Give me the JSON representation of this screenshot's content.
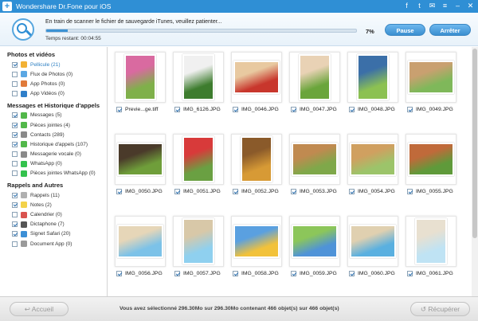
{
  "window": {
    "title": "Wondershare Dr.Fone pour iOS",
    "app_icon": "+"
  },
  "titlebar_icons": [
    "facebook-icon",
    "twitter-icon",
    "feedback-icon",
    "menu-icon",
    "minimize-icon",
    "close-icon"
  ],
  "titlebar_glyphs": [
    "f",
    "t",
    "✉",
    "≡",
    "–",
    "✕"
  ],
  "scan": {
    "message": "En train de scanner le fichier de sauvegarde iTunes, veuillez patienter...",
    "progress_percent": 7,
    "progress_label": "7%",
    "time_remaining": "Temps restant: 00:04:55",
    "pause_label": "Pause",
    "stop_label": "Arrêter"
  },
  "sidebar": {
    "sections": [
      {
        "title": "Photos et vidéos",
        "items": [
          {
            "label": "Pellicule (21)",
            "checked": true,
            "active": true,
            "color": "#f2b134"
          },
          {
            "label": "Flux de Photos (0)",
            "checked": false,
            "color": "#5aa7e3"
          },
          {
            "label": "App Photos (0)",
            "checked": false,
            "color": "#e07a3a"
          },
          {
            "label": "App Vidéos (0)",
            "checked": false,
            "color": "#2f7fc9"
          }
        ]
      },
      {
        "title": "Messages et Historique d'appels",
        "items": [
          {
            "label": "Messages (5)",
            "checked": true,
            "color": "#52b84a"
          },
          {
            "label": "Pièces jointes (4)",
            "checked": true,
            "color": "#52b84a"
          },
          {
            "label": "Contacts (289)",
            "checked": true,
            "color": "#8a8a8a"
          },
          {
            "label": "Historique d'appels (107)",
            "checked": true,
            "color": "#52b84a"
          },
          {
            "label": "Messagerie vocale (0)",
            "checked": false,
            "color": "#8a8a8a"
          },
          {
            "label": "WhatsApp (0)",
            "checked": false,
            "color": "#33c24d"
          },
          {
            "label": "Pièces jointes WhatsApp (0)",
            "checked": false,
            "color": "#33c24d"
          }
        ]
      },
      {
        "title": "Rappels and Autres",
        "items": [
          {
            "label": "Rappels (11)",
            "checked": true,
            "color": "#b0b0b0"
          },
          {
            "label": "Notes (2)",
            "checked": true,
            "color": "#f3d24a"
          },
          {
            "label": "Calendrier (0)",
            "checked": false,
            "color": "#d9534f"
          },
          {
            "label": "Dictaphone (7)",
            "checked": true,
            "color": "#555555"
          },
          {
            "label": "Signet Safari (20)",
            "checked": true,
            "color": "#3c8fd6"
          },
          {
            "label": "Document App (0)",
            "checked": false,
            "color": "#9a9a9a"
          }
        ]
      }
    ]
  },
  "photos": [
    {
      "name": "Previe...ge.tiff",
      "checked": true,
      "colors": [
        "#7fb04a",
        "#d96aa0"
      ],
      "portrait": true
    },
    {
      "name": "IMG_6126.JPG",
      "checked": true,
      "colors": [
        "#3d7c2e",
        "#f0f0f0"
      ],
      "portrait": true
    },
    {
      "name": "IMG_0046.JPG",
      "checked": true,
      "colors": [
        "#c8362c",
        "#e8c9a0"
      ],
      "portrait": false
    },
    {
      "name": "IMG_0047.JPG",
      "checked": true,
      "colors": [
        "#6aa53b",
        "#e9d2b5"
      ],
      "portrait": true
    },
    {
      "name": "IMG_0048.JPG",
      "checked": true,
      "colors": [
        "#8cc152",
        "#3b6fa8"
      ],
      "portrait": true
    },
    {
      "name": "IMG_0049.JPG",
      "checked": true,
      "colors": [
        "#7fb85a",
        "#c9a070"
      ],
      "portrait": false
    },
    {
      "name": "IMG_0050.JPG",
      "checked": true,
      "colors": [
        "#6f9e3a",
        "#4a3a2a"
      ],
      "portrait": false
    },
    {
      "name": "IMG_0051.JPG",
      "checked": true,
      "colors": [
        "#6aa042",
        "#d83a3a"
      ],
      "portrait": true
    },
    {
      "name": "IMG_0052.JPG",
      "checked": true,
      "colors": [
        "#d79a35",
        "#8a5a2a"
      ],
      "portrait": true
    },
    {
      "name": "IMG_0053.JPG",
      "checked": true,
      "colors": [
        "#7fa84a",
        "#c08a50"
      ],
      "portrait": false
    },
    {
      "name": "IMG_0054.JPG",
      "checked": true,
      "colors": [
        "#9cc46a",
        "#d0a060"
      ],
      "portrait": false
    },
    {
      "name": "IMG_0055.JPG",
      "checked": true,
      "colors": [
        "#5f9a3a",
        "#c06a3a"
      ],
      "portrait": false
    },
    {
      "name": "IMG_0056.JPG",
      "checked": true,
      "colors": [
        "#7cc2e8",
        "#e6d6b8"
      ],
      "portrait": false
    },
    {
      "name": "IMG_0057.JPG",
      "checked": true,
      "colors": [
        "#8fd0ef",
        "#d8c8a8"
      ],
      "portrait": true
    },
    {
      "name": "IMG_0058.JPG",
      "checked": true,
      "colors": [
        "#f2c23a",
        "#5aa0e0"
      ],
      "portrait": false
    },
    {
      "name": "IMG_0059.JPG",
      "checked": true,
      "colors": [
        "#4f93d8",
        "#8cc65a"
      ],
      "portrait": false
    },
    {
      "name": "IMG_0060.JPG",
      "checked": true,
      "colors": [
        "#5ab0e0",
        "#e0d0b0"
      ],
      "portrait": false
    },
    {
      "name": "IMG_0061.JPG",
      "checked": true,
      "colors": [
        "#bfe3f4",
        "#e8e0d0"
      ],
      "portrait": true
    }
  ],
  "footer": {
    "home_label": "Accueil",
    "recover_label": "Récupérer",
    "summary": "Vous avez sélectionné 296.30Mo sur 296.30Mo contenant 466 objet(s) sur 466 objet(s)"
  }
}
